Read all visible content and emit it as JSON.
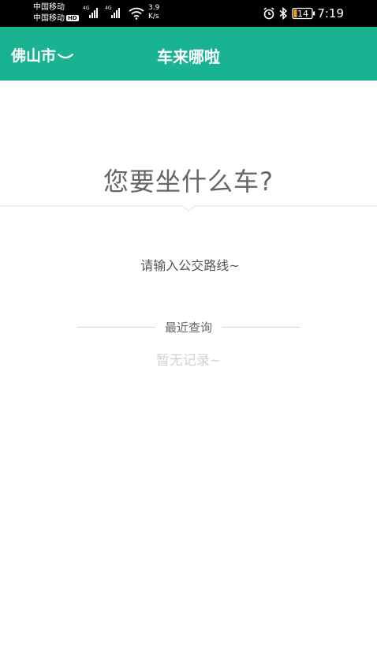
{
  "status_bar": {
    "carrier1": "中国移动",
    "carrier2": "中国移动",
    "hd": "HD",
    "net_type1": "4G",
    "net_type2": "4G",
    "speed_value": "3.9",
    "speed_unit": "K/s",
    "battery": "14",
    "time": "7:19"
  },
  "header": {
    "city": "佛山市",
    "title": "车来哪啦"
  },
  "main": {
    "question": "您要坐什么车?",
    "search_placeholder": "请输入公交路线~",
    "recent_title": "最近查询",
    "empty_text": "暂无记录~"
  },
  "colors": {
    "brand": "#1ab391",
    "status_bar": "#000000"
  },
  "icons": [
    "signal-icon",
    "wifi-icon",
    "alarm-icon",
    "bluetooth-icon",
    "battery-icon",
    "chevron-down-icon"
  ]
}
